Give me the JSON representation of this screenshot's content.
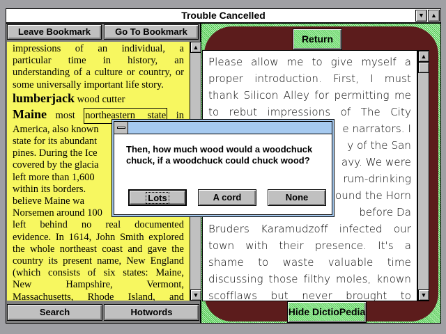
{
  "window": {
    "title": "Trouble Cancelled",
    "min_icon": "▼",
    "max_icon": "▲"
  },
  "left": {
    "buttons": {
      "leave_bookmark": "Leave Bookmark",
      "go_to_bookmark": "Go To Bookmark",
      "search": "Search",
      "hotwords": "Hotwords"
    },
    "lines": [
      "impressions of an individual, a",
      "particular time in history, an",
      "understanding of a culture or country, or",
      "some universally important life story."
    ],
    "entry1": {
      "term": "lumberjack",
      "def": "wood cutter"
    },
    "entry2": {
      "term": "Maine",
      "def_start": "most",
      "hotword": "northeastern state",
      "def_end": "in"
    },
    "lines2": [
      "America, also known",
      "state for its abundant",
      "pines. During the Ice",
      "covered by the glacia",
      "left more than 1,600",
      "within its borders.",
      "believe Maine wa",
      "Norsemen around 100",
      "left behind no real documented",
      "evidence. In 1614, John Smith explored",
      "the whole northeast coast and gave the",
      "country its present name, New England",
      "(which consists of six states: Maine,",
      "New Hampshire, Vermont,",
      "Massachusetts, Rhode Island, and"
    ]
  },
  "right": {
    "return_label": "Return",
    "hide_label": "Hide DictioPedia",
    "lines": [
      "Please allow me to give myself a",
      "proper introduction. First, I must",
      "thank Silicon Alley for permitting me",
      "to rebut impressions of The City",
      "e narrators. I",
      "y of the San",
      "avy. We were",
      "rum-drinking",
      "ound the Horn",
      "before Da",
      "Bruders Karamudzoff infected our",
      "town with their presence. It's a",
      "shame to waste valuable time",
      "discussing those filthy moles, known",
      "scofflaws but never brought to"
    ]
  },
  "dialog": {
    "message": "Then, how much wood would a woodchuck chuck, if a woodchuck could chuck wood?",
    "buttons": [
      "Lots",
      "A cord",
      "None"
    ]
  },
  "colors": {
    "yellow": "#ffff80",
    "green": "#9ee89e",
    "frame": "#6a2020",
    "dialog_title": "#a6caf0"
  }
}
